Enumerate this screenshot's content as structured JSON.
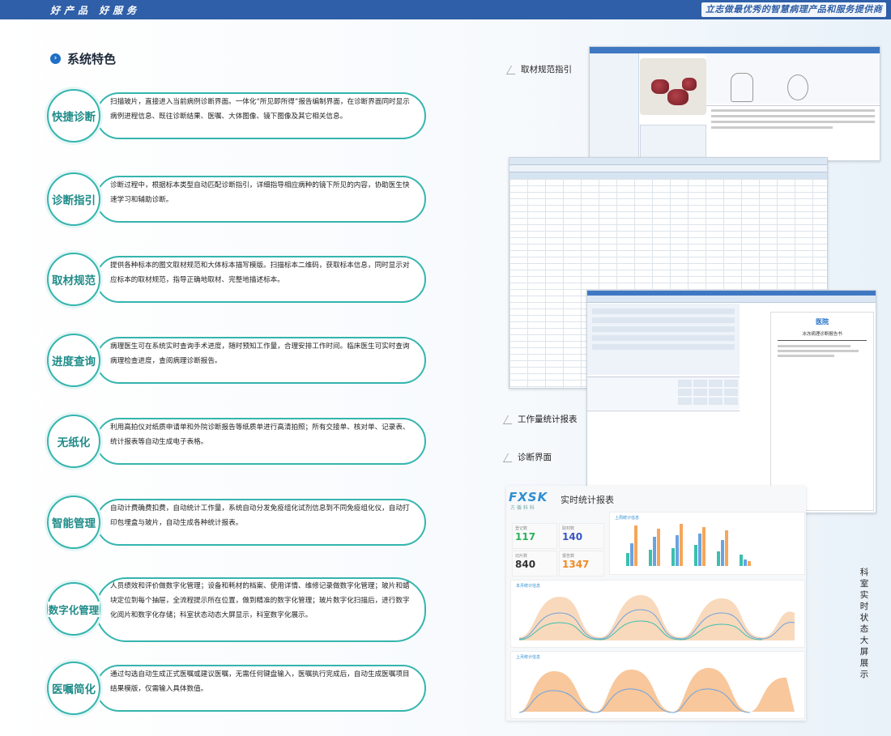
{
  "header": {
    "left_slogan": "好产品 好服务",
    "right_slogan": "立志做最优秀的智慧病理产品和服务提供商"
  },
  "section": {
    "title": "系统特色"
  },
  "features": [
    {
      "title": "快捷诊断",
      "desc": "扫描玻片，直接进入当前病例诊断界面。一体化“所见即所得”报告编制界面，在诊断界面同时显示病例进程信息、既往诊断结果、医嘱、大体图像、镜下图像及其它相关信息。"
    },
    {
      "title": "诊断指引",
      "desc": "诊断过程中，根据标本类型自动匹配诊断指引，详细指导相应病种的镜下所见的内容，协助医生快速学习和辅助诊断。"
    },
    {
      "title": "取材规范",
      "desc": "提供各种标本的图文取材规范和大体标本描写模版。扫描标本二维码，获取标本信息，同时显示对应标本的取材规范，指导正确地取材、完整地描述标本。"
    },
    {
      "title": "进度查询",
      "desc": "病理医生可在系统实时查询手术进度，随时预知工作量，合理安排工作时间。临床医生可实时查询病理检查进度，查阅病理诊断报告。"
    },
    {
      "title": "无纸化",
      "desc": "利用高拍仪对纸质申请单和外院诊断报告等纸质单进行高清拍照；所有交接单、核对单、记录表、统计报表等自动生成电子表格。"
    },
    {
      "title": "智能管理",
      "desc": "自动计费确费扣费，自动统计工作量，系统自动分发免疫组化试剂信息到不同免疫组化仪，自动打印包埋盒与玻片，自动生成各种统计报表。"
    },
    {
      "title": "数字化管理",
      "desc": "人员绩效和评价做数字化管理；设备和耗材的档案、使用详情、维修记录做数字化管理；玻片和蜡块定位到每个抽屉，全流程提示所在位置，做到精准的数字化管理；玻片数字化扫描后，进行数字化阅片和数字化存储；科室状态动态大屏显示，科室数字化展示。"
    },
    {
      "title": "医嘱简化",
      "desc": "通过勾选自动生成正式医嘱或建议医嘱，无需任何键盘输入，医嘱执行完成后，自动生成医嘱项目结果模版，仅需输入具体数值。"
    }
  ],
  "captions": {
    "sampling_guide": "取材规范指引",
    "workload_report": "工作量统计报表",
    "diagnosis_ui": "诊断界面",
    "dashboard": "科室实时状态大屏展示"
  },
  "dashboard": {
    "logo": "FXSK",
    "logo_sub": "方 循 科 科",
    "title": "实时统计报表",
    "stats": [
      {
        "label": "登记数",
        "value": "117",
        "color": "#2db35d"
      },
      {
        "label": "取材数",
        "value": "140",
        "color": "#3a55c4"
      },
      {
        "label": "切片数",
        "value": "840",
        "color": "#333333"
      },
      {
        "label": "报告数",
        "value": "1347",
        "color": "#f08a24"
      }
    ],
    "panel_titles": [
      "上周统计信息",
      "本月统计信息",
      "上月统计信息"
    ]
  },
  "hospital_report": {
    "hospital_name": "医院",
    "report_title": "冰冻病理诊断报告书"
  },
  "colors": {
    "accent": "#34b5ae",
    "header_blue": "#2f5fa8",
    "chart_orange": "#f5a65b",
    "chart_blue": "#6aa3e0",
    "chart_teal": "#3bbfae"
  }
}
